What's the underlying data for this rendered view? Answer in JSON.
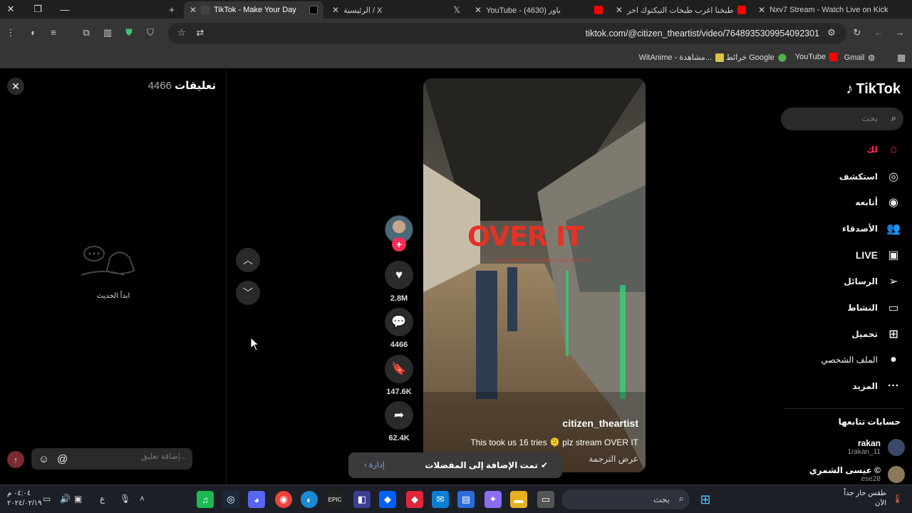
{
  "browser": {
    "tabs": [
      {
        "title": "TikTok - Make Your Day",
        "active": true
      },
      {
        "title": "الرئيسية / X",
        "active": false
      },
      {
        "title": "YouTube - (4630) باور",
        "active": false
      },
      {
        "title": "طبخنا اغرب طبخات التيكتوك اخر",
        "active": false
      },
      {
        "title": "Nxv7 Stream - Watch Live on Kick",
        "active": false
      }
    ],
    "url": "tiktok.com/@citizen_theartist/video/7648935309954092301",
    "bookmarks": [
      "Gmail",
      "YouTube",
      "خرائط Google",
      "WitAnime - مشاهدة..."
    ]
  },
  "comments_panel": {
    "title": "تعليقات",
    "count": "4466",
    "empty_text": "ابدأ الحديث",
    "input_placeholder": "إضافة تعليق...",
    "mention_symbol": "@"
  },
  "video": {
    "overlay_title": "OVER IT",
    "overlay_subtitle": "A SONG BY CITIZEN THE ARTIST",
    "author": "citizen_theartist",
    "caption": "This took us 16 tries 🫠 plz stream OVER IT",
    "translate": "عرض الترجمة"
  },
  "actions": {
    "likes": "2.8M",
    "comments": "4466",
    "saves": "147.6K",
    "shares": "62.4K"
  },
  "toast": {
    "message": "تمت الإضافة إلى المفضلات",
    "manage": "إدارة"
  },
  "sidebar": {
    "logo": "TikTok",
    "search_placeholder": "بحث",
    "nav": [
      {
        "label": "لك",
        "icon": "home-icon"
      },
      {
        "label": "استكشف",
        "icon": "compass-icon"
      },
      {
        "label": "أتابعه",
        "icon": "following-avatar-icon"
      },
      {
        "label": "الأصدقاء",
        "icon": "friends-icon"
      },
      {
        "label": "LIVE",
        "icon": "live-icon"
      },
      {
        "label": "الرسائل",
        "icon": "messages-icon"
      },
      {
        "label": "النشاط",
        "icon": "activity-icon"
      },
      {
        "label": "تحميل",
        "icon": "upload-icon"
      },
      {
        "label": "الملف الشخصي",
        "icon": "profile-icon"
      },
      {
        "label": "المزيد",
        "icon": "more-icon"
      }
    ],
    "following_title": "حسابات تتابعها",
    "following": [
      {
        "name": "rakan",
        "handle": "1rakan_11"
      },
      {
        "name": "عيسى الشمري ©",
        "handle": "ese28"
      }
    ]
  },
  "taskbar": {
    "search_label": "بحث",
    "weather_title": "طقس حار جداً",
    "weather_sub": "الآن",
    "time": "٠٤:٠٤ م",
    "date": "٢٠٢٤/٠٢/١٩",
    "lang": "ع"
  },
  "colors": {
    "accent": "#fe2c55",
    "toast_link": "#7aa8ff",
    "title_red": "#e23325"
  }
}
